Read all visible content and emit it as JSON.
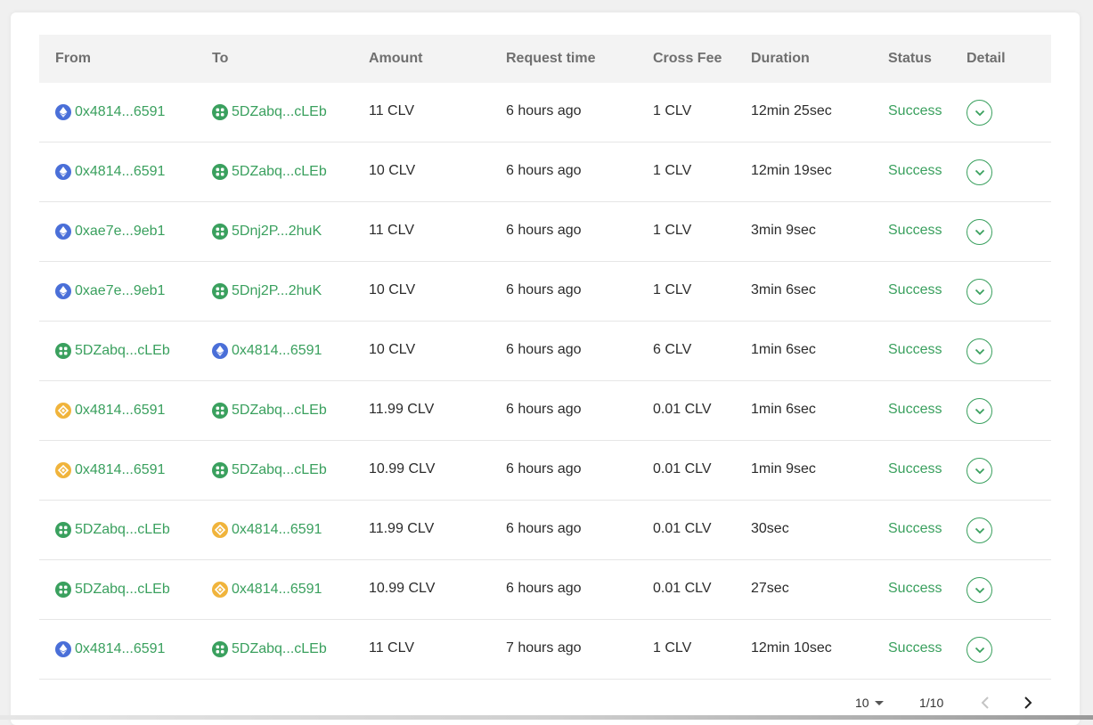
{
  "table": {
    "headers": [
      "From",
      "To",
      "Amount",
      "Request time",
      "Cross Fee",
      "Duration",
      "Status",
      "Detail"
    ],
    "rows": [
      {
        "from_chain": "eth",
        "from": "0x4814...6591",
        "to_chain": "clv",
        "to": "5DZabq...cLEb",
        "amount": "11 CLV",
        "time": "6 hours ago",
        "fee": "1 CLV",
        "duration": "12min 25sec",
        "status": "Success"
      },
      {
        "from_chain": "eth",
        "from": "0x4814...6591",
        "to_chain": "clv",
        "to": "5DZabq...cLEb",
        "amount": "10 CLV",
        "time": "6 hours ago",
        "fee": "1 CLV",
        "duration": "12min 19sec",
        "status": "Success"
      },
      {
        "from_chain": "eth",
        "from": "0xae7e...9eb1",
        "to_chain": "clv",
        "to": "5Dnj2P...2huK",
        "amount": "11 CLV",
        "time": "6 hours ago",
        "fee": "1 CLV",
        "duration": "3min 9sec",
        "status": "Success"
      },
      {
        "from_chain": "eth",
        "from": "0xae7e...9eb1",
        "to_chain": "clv",
        "to": "5Dnj2P...2huK",
        "amount": "10 CLV",
        "time": "6 hours ago",
        "fee": "1 CLV",
        "duration": "3min 6sec",
        "status": "Success"
      },
      {
        "from_chain": "clv",
        "from": "5DZabq...cLEb",
        "to_chain": "eth",
        "to": "0x4814...6591",
        "amount": "10 CLV",
        "time": "6 hours ago",
        "fee": "6 CLV",
        "duration": "1min 6sec",
        "status": "Success"
      },
      {
        "from_chain": "bsc",
        "from": "0x4814...6591",
        "to_chain": "clv",
        "to": "5DZabq...cLEb",
        "amount": "11.99 CLV",
        "time": "6 hours ago",
        "fee": "0.01 CLV",
        "duration": "1min 6sec",
        "status": "Success"
      },
      {
        "from_chain": "bsc",
        "from": "0x4814...6591",
        "to_chain": "clv",
        "to": "5DZabq...cLEb",
        "amount": "10.99 CLV",
        "time": "6 hours ago",
        "fee": "0.01 CLV",
        "duration": "1min 9sec",
        "status": "Success"
      },
      {
        "from_chain": "clv",
        "from": "5DZabq...cLEb",
        "to_chain": "bsc",
        "to": "0x4814...6591",
        "amount": "11.99 CLV",
        "time": "6 hours ago",
        "fee": "0.01 CLV",
        "duration": "30sec",
        "status": "Success"
      },
      {
        "from_chain": "clv",
        "from": "5DZabq...cLEb",
        "to_chain": "bsc",
        "to": "0x4814...6591",
        "amount": "10.99 CLV",
        "time": "6 hours ago",
        "fee": "0.01 CLV",
        "duration": "27sec",
        "status": "Success"
      },
      {
        "from_chain": "eth",
        "from": "0x4814...6591",
        "to_chain": "clv",
        "to": "5DZabq...cLEb",
        "amount": "11 CLV",
        "time": "7 hours ago",
        "fee": "1 CLV",
        "duration": "12min 10sec",
        "status": "Success"
      }
    ]
  },
  "pagination": {
    "page_size": "10",
    "page_info": "1/10"
  },
  "colors": {
    "accent_green": "#3aa05e",
    "eth_blue": "#4a6fd8",
    "bsc_orange": "#f0b43c",
    "header_bg": "#f3f3f3"
  }
}
